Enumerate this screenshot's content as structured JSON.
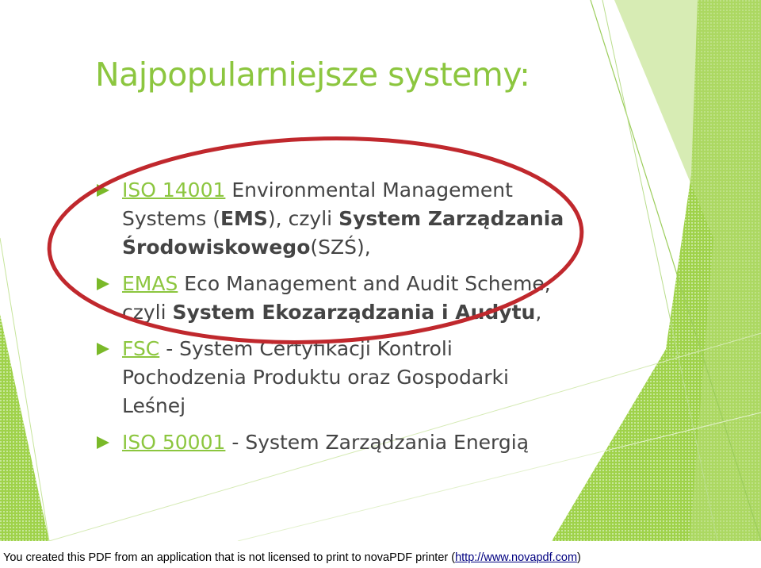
{
  "slide": {
    "title": "Najpopularniejsze systemy:",
    "accent_color": "#8cc63f",
    "ellipse_color": "#c0282d",
    "bullets": [
      {
        "link": "ISO 14001",
        "t1": " Environmental Management",
        "t2": "Systems (",
        "b1": "EMS",
        "t3": "), czyli ",
        "b2": "System Zarządzania",
        "b3": "Środowiskowego",
        "t4": "(SZŚ),"
      },
      {
        "link": "EMAS",
        "t1": " Eco Management and Audit Scheme,",
        "t2": "czyli ",
        "b1": "System Ekozarządzania i Audytu",
        "t3": ","
      },
      {
        "link": "FSC",
        "t1": " - System Certyfikacji Kontroli",
        "t2": "Pochodzenia Produktu oraz Gospodarki",
        "t3": "Leśnej"
      },
      {
        "link": "ISO 50001",
        "t1": " - System Zarządzania Energią"
      }
    ]
  },
  "footer": {
    "text": "You created this PDF from an application that is not licensed to print to novaPDF printer (",
    "link": "http://www.novapdf.com",
    "suffix": ")"
  }
}
